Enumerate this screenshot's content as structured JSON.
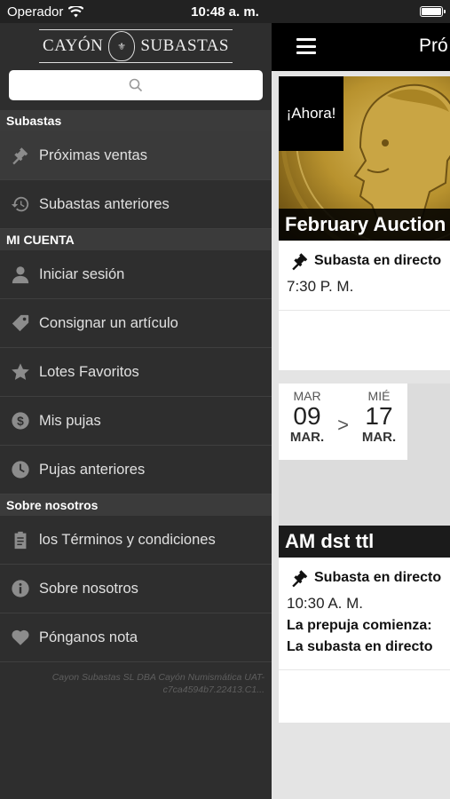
{
  "status_bar": {
    "carrier": "Operador",
    "time": "10:48 a. m."
  },
  "brand": {
    "left": "CAYÓN",
    "right": "SUBASTAS"
  },
  "drawer": {
    "sections": [
      {
        "title": "Subastas",
        "items": [
          {
            "label": "Próximas ventas",
            "icon": "gavel-icon",
            "active": true
          },
          {
            "label": "Subastas anteriores",
            "icon": "history-icon"
          }
        ]
      },
      {
        "title": "MI CUENTA",
        "items": [
          {
            "label": "Iniciar sesión",
            "icon": "user-icon"
          },
          {
            "label": "Consignar un artículo",
            "icon": "tag-icon"
          },
          {
            "label": "Lotes Favoritos",
            "icon": "star-icon"
          },
          {
            "label": "Mis pujas",
            "icon": "dollar-icon"
          },
          {
            "label": "Pujas anteriores",
            "icon": "clock-icon"
          }
        ]
      },
      {
        "title": "Sobre nosotros",
        "items": [
          {
            "label": "los Términos y condiciones",
            "icon": "clipboard-icon"
          },
          {
            "label": "Sobre nosotros",
            "icon": "info-icon"
          },
          {
            "label": "Pónganos nota",
            "icon": "heart-icon"
          }
        ]
      }
    ],
    "footer_line1": "Cayon Subastas SL DBA Cayón Numismática UAT-",
    "footer_line2": "c7ca4594b7.22413.C1..."
  },
  "main": {
    "nav_title": "Pró",
    "cards": [
      {
        "badge": "¡Ahora!",
        "title": "February Auction",
        "live_label": "Subasta en directo",
        "time": "7:30 P. M.",
        "partial": "8"
      },
      {
        "start": {
          "weekday": "MAR",
          "day": "09",
          "month": "MAR."
        },
        "end": {
          "weekday": "MIÉ",
          "day": "17",
          "month": "MAR."
        },
        "arrow": ">",
        "title": "AM dst ttl",
        "live_label": "Subasta en directo",
        "time": "10:30 A. M.",
        "prebid": "La prepuja comienza:",
        "live_start": "La subasta en directo"
      }
    ]
  },
  "colors": {
    "drawer_bg": "#2e2e2e",
    "section_bg": "#3b3b3b",
    "navbar": "#000000",
    "icon": "#8c8c8c"
  }
}
